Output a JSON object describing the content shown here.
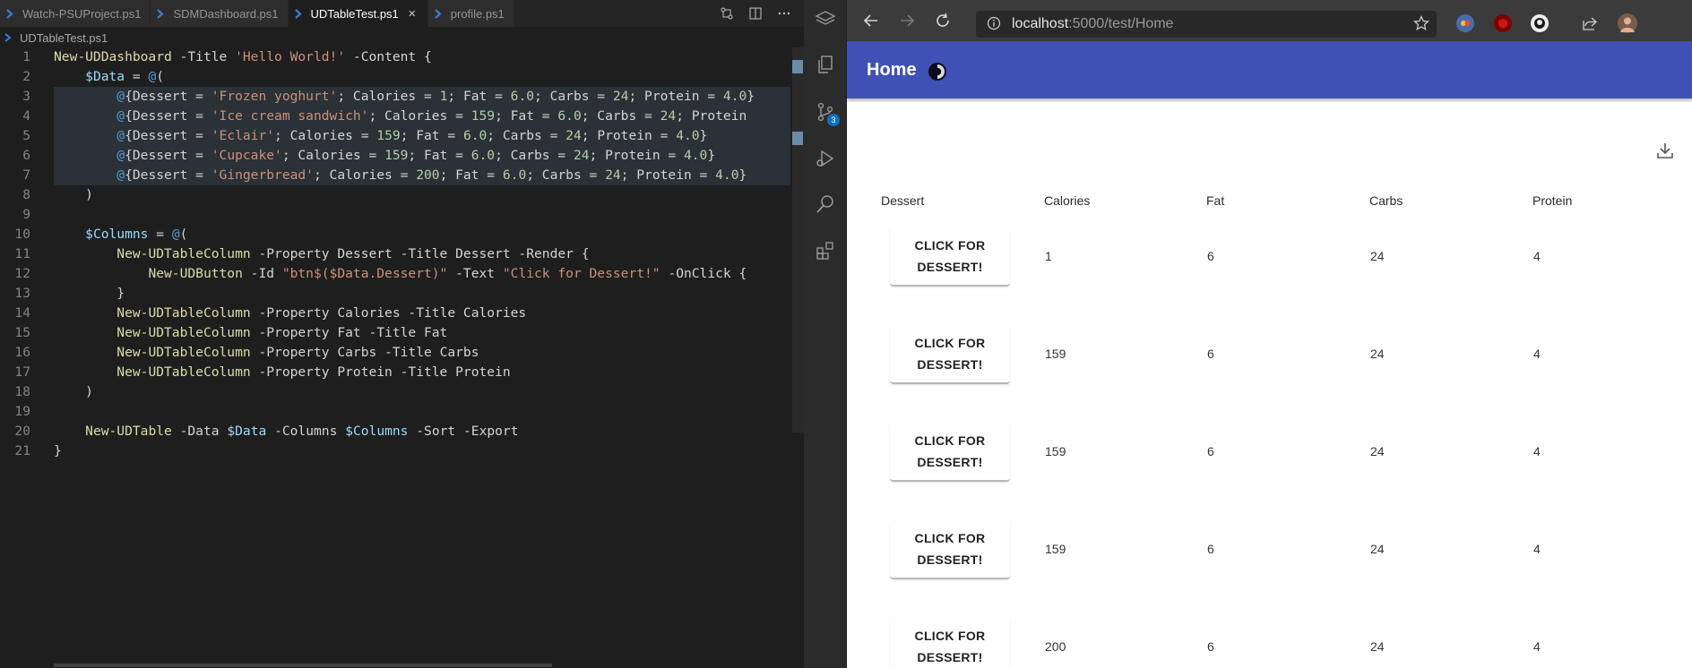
{
  "editor": {
    "tabs": [
      {
        "label": "Watch-PSUProject.ps1",
        "active": false
      },
      {
        "label": "SDMDashboard.ps1",
        "active": false
      },
      {
        "label": "UDTableTest.ps1",
        "active": true
      },
      {
        "label": "profile.ps1",
        "active": false
      }
    ],
    "tab_close_glyph": "×",
    "breadcrumb": "UDTableTest.ps1",
    "line_numbers": [
      "1",
      "2",
      "3",
      "4",
      "5",
      "6",
      "7",
      "8",
      "9",
      "10",
      "11",
      "12",
      "13",
      "14",
      "15",
      "16",
      "17",
      "18",
      "19",
      "20",
      "21"
    ],
    "lines": [
      "New-UDDashboard -Title 'Hello World!' -Content {",
      "    $Data = @(",
      "        @{Dessert = 'Frozen yoghurt'; Calories = 1; Fat = 6.0; Carbs = 24; Protein = 4.0}",
      "        @{Dessert = 'Ice cream sandwich'; Calories = 159; Fat = 6.0; Carbs = 24; Protein",
      "        @{Dessert = 'Eclair'; Calories = 159; Fat = 6.0; Carbs = 24; Protein = 4.0}",
      "        @{Dessert = 'Cupcake'; Calories = 159; Fat = 6.0; Carbs = 24; Protein = 4.0}",
      "        @{Dessert = 'Gingerbread'; Calories = 200; Fat = 6.0; Carbs = 24; Protein = 4.0}",
      "    )",
      "",
      "    $Columns = @(",
      "        New-UDTableColumn -Property Dessert -Title Dessert -Render {",
      "            New-UDButton -Id \"btn$($Data.Dessert)\" -Text \"Click for Dessert!\" -OnClick {",
      "        }",
      "        New-UDTableColumn -Property Calories -Title Calories",
      "        New-UDTableColumn -Property Fat -Title Fat",
      "        New-UDTableColumn -Property Carbs -Title Carbs",
      "        New-UDTableColumn -Property Protein -Title Protein",
      "    )",
      "",
      "    New-UDTable -Data $Data -Columns $Columns -Sort -Export",
      "}"
    ]
  },
  "browser": {
    "url_host": "localhost",
    "url_rest": ":5000/test/Home",
    "page": {
      "title": "Home",
      "columns": [
        "Dessert",
        "Calories",
        "Fat",
        "Carbs",
        "Protein"
      ],
      "button_label": "CLICK FOR DESSERT!",
      "rows": [
        {
          "calories": "1",
          "fat": "6",
          "carbs": "24",
          "protein": "4"
        },
        {
          "calories": "159",
          "fat": "6",
          "carbs": "24",
          "protein": "4"
        },
        {
          "calories": "159",
          "fat": "6",
          "carbs": "24",
          "protein": "4"
        },
        {
          "calories": "159",
          "fat": "6",
          "carbs": "24",
          "protein": "4"
        },
        {
          "calories": "200",
          "fat": "6",
          "carbs": "24",
          "protein": "4"
        }
      ]
    },
    "sidebar_badge": "3"
  },
  "colors": {
    "appbar": "#3f51b5",
    "editor_bg": "#1e1e1e",
    "keyword": "#dcdcaa",
    "variable": "#9cdcfe",
    "string": "#ce9178",
    "number": "#b5cea8"
  },
  "icons": [
    "powershell-icon",
    "source-control-icon",
    "split-editor-icon",
    "more-icon",
    "explorer-icon",
    "search-icon",
    "run-debug-icon",
    "extensions-icon",
    "back-icon",
    "forward-icon",
    "refresh-icon",
    "info-icon",
    "favorite-star-icon",
    "profile-avatar",
    "download-icon",
    "theme-toggle-icon"
  ]
}
